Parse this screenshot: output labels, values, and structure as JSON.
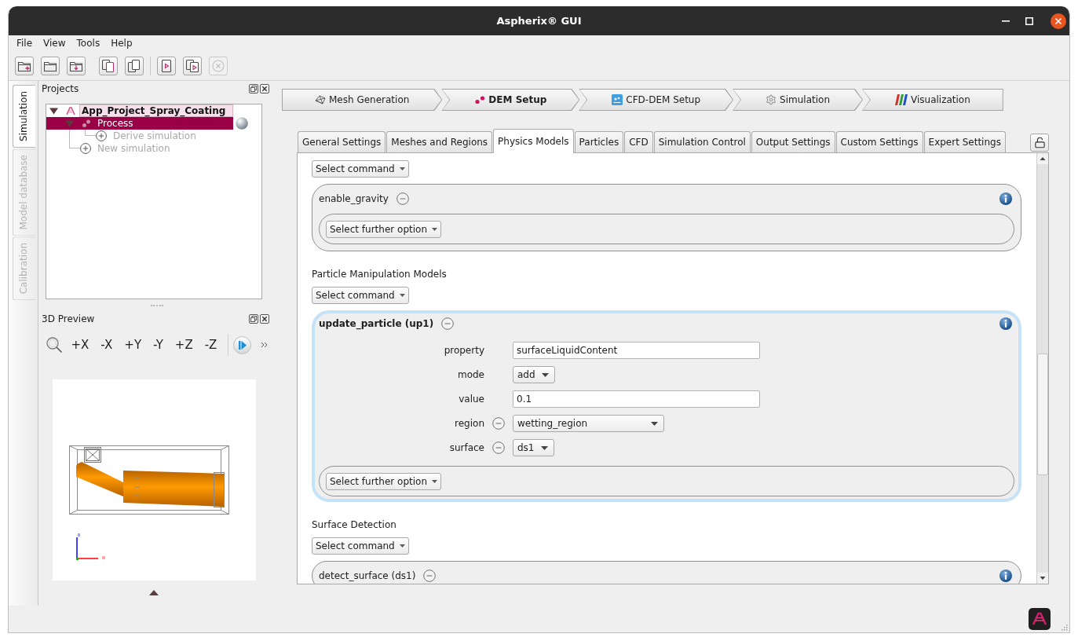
{
  "window": {
    "title": "Aspherix® GUI"
  },
  "menu": [
    {
      "label": "File"
    },
    {
      "label": "View"
    },
    {
      "label": "Tools"
    },
    {
      "label": "Help"
    }
  ],
  "toolbar": [
    {
      "divider": false,
      "items": [
        {
          "disabled": false
        },
        {
          "disabled": false
        },
        {
          "disabled": false
        }
      ]
    },
    {
      "divider": false,
      "items": [
        {
          "disabled": false
        },
        {
          "disabled": false
        }
      ]
    },
    {
      "divider": true,
      "items": [
        {
          "disabled": false
        },
        {
          "disabled": false
        },
        {
          "disabled": true
        }
      ]
    }
  ],
  "side_tabs": [
    {
      "label": "Simulation",
      "selected": true,
      "disabled": false
    },
    {
      "label": "Model database",
      "selected": false,
      "disabled": true
    },
    {
      "label": "Calibration",
      "selected": false,
      "disabled": true
    }
  ],
  "projects": {
    "title": "Projects",
    "tree": [
      {
        "kind": "project",
        "label": "App_Project_Spray_Coating",
        "current": true,
        "expanded": true,
        "selected": false,
        "children": [
          {
            "kind": "process",
            "label": "Process",
            "current": false,
            "expanded": true,
            "selected": true,
            "children": [
              {
                "kind": "add",
                "label": "Derive simulation",
                "selected": false
              }
            ]
          },
          {
            "kind": "add",
            "label": "New simulation",
            "selected": false
          }
        ]
      }
    ]
  },
  "preview": {
    "title": "3D Preview",
    "views": [
      {
        "label": "+X"
      },
      {
        "label": "-X"
      },
      {
        "label": "+Y"
      },
      {
        "label": "-Y"
      },
      {
        "label": "+Z"
      },
      {
        "label": "-Z"
      }
    ]
  },
  "workflow": [
    {
      "label": "Mesh Generation",
      "selected": false
    },
    {
      "label": "DEM Setup",
      "selected": true
    },
    {
      "label": "CFD-DEM Setup",
      "selected": false
    },
    {
      "label": "Simulation",
      "selected": false
    },
    {
      "label": "Visualization",
      "selected": false
    }
  ],
  "tabs": [
    {
      "label": "General Settings",
      "selected": false
    },
    {
      "label": "Meshes and Regions",
      "selected": false
    },
    {
      "label": "Physics Models",
      "selected": true
    },
    {
      "label": "Particles",
      "selected": false
    },
    {
      "label": "CFD",
      "selected": false
    },
    {
      "label": "Simulation Control",
      "selected": false
    },
    {
      "label": "Output Settings",
      "selected": false
    },
    {
      "label": "Custom Settings",
      "selected": false
    },
    {
      "label": "Expert Settings",
      "selected": false
    }
  ],
  "sections": [
    {
      "command": "Select command",
      "models": [
        {
          "name": "enable_gravity",
          "selected": false,
          "further": "Select further option"
        }
      ]
    },
    {
      "heading": "Particle Manipulation Models",
      "command": "Select command",
      "models": [
        {
          "name": "update_particle (up1)",
          "selected": true,
          "fields": [
            {
              "label": "property",
              "kind": "text",
              "value": "surfaceLiquidContent",
              "removable": false
            },
            {
              "label": "mode",
              "kind": "dropdown",
              "value": "add",
              "removable": false
            },
            {
              "label": "value",
              "kind": "text",
              "value": "0.1",
              "removable": false
            },
            {
              "label": "region",
              "kind": "dropdown",
              "value": "wetting_region",
              "removable": true
            },
            {
              "label": "surface",
              "kind": "dropdown",
              "value": "ds1",
              "removable": true
            }
          ],
          "further": "Select further option"
        }
      ]
    },
    {
      "heading": "Surface Detection",
      "command": "Select command",
      "models": [
        {
          "name": "detect_surface (ds1)",
          "selected": false
        }
      ]
    }
  ]
}
